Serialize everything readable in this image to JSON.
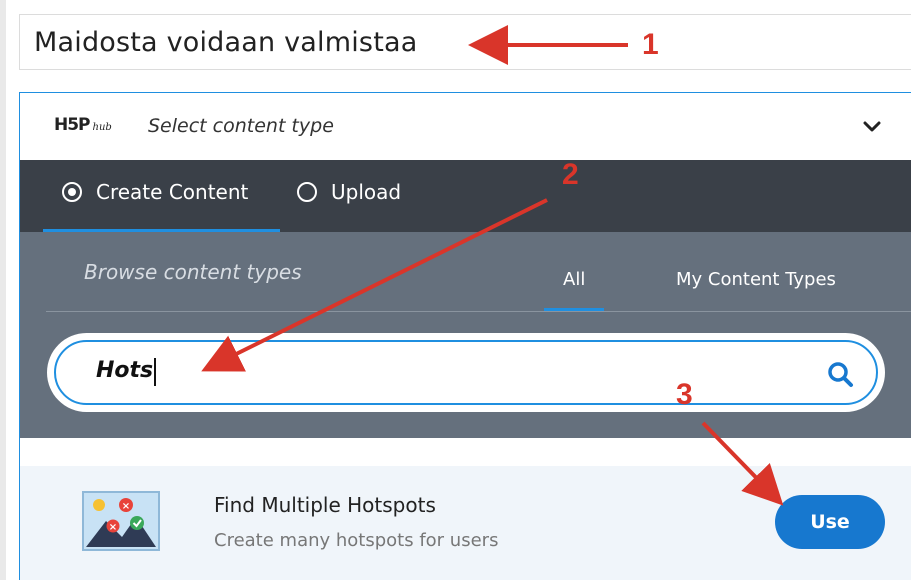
{
  "title_field": {
    "value": "Maidosta voidaan valmistaa"
  },
  "hub": {
    "logo_main": "H5P",
    "logo_sub": "hub",
    "select_label": "Select content type",
    "tabs": [
      {
        "label": "Create Content",
        "selected": true
      },
      {
        "label": "Upload",
        "selected": false
      }
    ],
    "browse_title": "Browse content types",
    "filter_tabs": [
      {
        "label": "All",
        "active": true
      },
      {
        "label": "My Content Types",
        "active": false
      }
    ],
    "search": {
      "value": "Hots"
    },
    "results": [
      {
        "title": "Find Multiple Hotspots",
        "description": "Create many hotspots for users",
        "action_label": "Use"
      }
    ]
  },
  "annotations": [
    {
      "label": "1"
    },
    {
      "label": "2"
    },
    {
      "label": "3"
    }
  ],
  "icons": [
    "chevron-down-icon",
    "search-icon",
    "content-type-thumbnail-icon",
    "radio-selected-icon",
    "radio-unselected-icon"
  ],
  "colors": {
    "accent": "#1f8fe0",
    "button": "#1778cf",
    "tabbar": "#3a4048",
    "browse_panel": "#65707d",
    "annotation": "#d9352a"
  }
}
